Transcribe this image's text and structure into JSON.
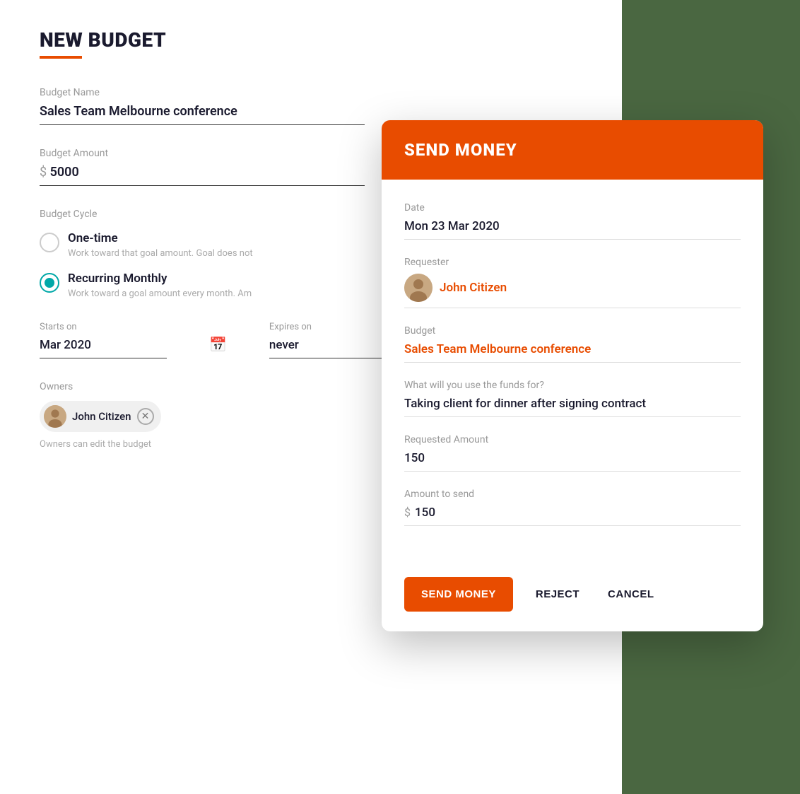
{
  "page": {
    "title": "NEW BUDGET"
  },
  "new_budget": {
    "budget_name_label": "Budget Name",
    "budget_name_value": "Sales Team Melbourne conference",
    "budget_amount_label": "Budget Amount",
    "budget_amount_value": "5000",
    "budget_cycle_label": "Budget Cycle",
    "one_time_label": "One-time",
    "one_time_desc": "Work toward that goal amount. Goal does not",
    "recurring_label": "Recurring Monthly",
    "recurring_desc": "Work toward a goal amount every month. Am",
    "starts_on_label": "Starts on",
    "starts_on_value": "Mar 2020",
    "expires_on_label": "Expires on",
    "expires_on_value": "never",
    "owners_label": "Owners",
    "owner_name": "John Citizen",
    "owners_hint": "Owners can edit the budget"
  },
  "send_money_modal": {
    "title": "SEND MONEY",
    "date_label": "Date",
    "date_value": "Mon 23 Mar 2020",
    "requester_label": "Requester",
    "requester_name": "John Citizen",
    "budget_label": "Budget",
    "budget_value": "Sales Team Melbourne conference",
    "funds_label": "What will you use the funds for?",
    "funds_value": "Taking client for dinner after signing contract",
    "requested_amount_label": "Requested Amount",
    "requested_amount_value": "150",
    "amount_to_send_label": "Amount to send",
    "amount_to_send_dollar": "$",
    "amount_to_send_value": "150",
    "btn_send_money": "SEND MONEY",
    "btn_reject": "REJECT",
    "btn_cancel": "CANCEL"
  }
}
